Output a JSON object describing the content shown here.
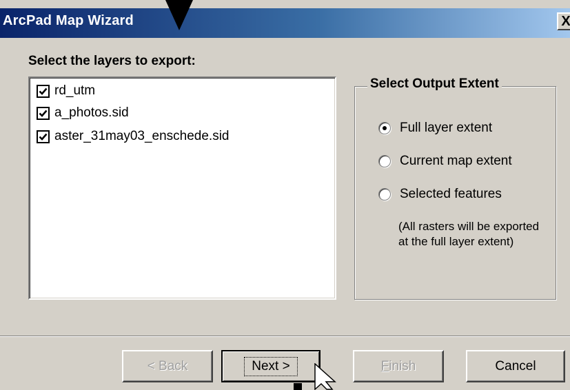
{
  "window": {
    "title": "ArcPad Map Wizard",
    "close_symbol": "X"
  },
  "layers_section": {
    "heading": "Select the layers to export:",
    "layers": [
      {
        "label": "rd_utm",
        "checked": true
      },
      {
        "label": "a_photos.sid",
        "checked": true
      },
      {
        "label": "aster_31may03_enschede.sid",
        "checked": true
      }
    ]
  },
  "output_extent": {
    "legend": "Select Output Extent",
    "options": [
      {
        "label": "Full layer extent",
        "selected": true
      },
      {
        "label": "Current map extent",
        "selected": false
      },
      {
        "label": "Selected features",
        "selected": false
      }
    ],
    "note": "(All rasters will be exported at the full layer extent)"
  },
  "buttons": {
    "back": {
      "label": "< Back",
      "enabled": false
    },
    "next": {
      "label": "Next >",
      "enabled": true,
      "default": true
    },
    "finish": {
      "label_rest": "inish",
      "label_first": "F",
      "enabled": false
    },
    "cancel": {
      "label": "Cancel",
      "enabled": true
    }
  },
  "icons": {
    "close": "close-icon",
    "check": "check-icon",
    "radio_dot": "radio-dot-icon",
    "pointer": "arrow-pointer-icon",
    "cursor": "mouse-cursor-icon"
  },
  "colors": {
    "dialog_bg": "#d4d0c8",
    "title_start": "#0a246a",
    "title_end": "#a6caf0",
    "disabled_text": "#a0a0a0"
  }
}
